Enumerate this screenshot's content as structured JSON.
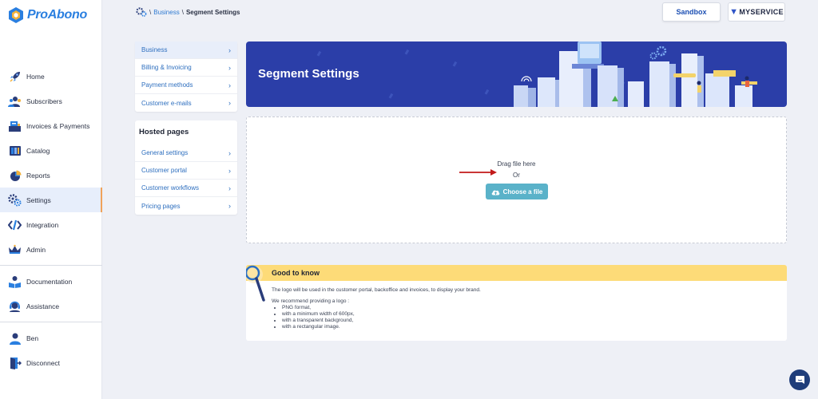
{
  "app": {
    "name": "ProAbono"
  },
  "sidebar": {
    "items": [
      {
        "label": "Home",
        "icon": "rocket-icon"
      },
      {
        "label": "Subscribers",
        "icon": "users-icon"
      },
      {
        "label": "Invoices & Payments",
        "icon": "cash-register-icon"
      },
      {
        "label": "Catalog",
        "icon": "catalog-icon"
      },
      {
        "label": "Reports",
        "icon": "pie-chart-icon"
      },
      {
        "label": "Settings",
        "icon": "gears-icon",
        "active": true
      },
      {
        "label": "Integration",
        "icon": "code-icon"
      },
      {
        "label": "Admin",
        "icon": "crown-icon"
      }
    ],
    "help_items": [
      {
        "label": "Documentation",
        "icon": "reader-icon"
      },
      {
        "label": "Assistance",
        "icon": "headset-icon"
      }
    ],
    "user_items": [
      {
        "label": "Ben",
        "icon": "user-icon"
      },
      {
        "label": "Disconnect",
        "icon": "door-icon"
      }
    ]
  },
  "breadcrumb": {
    "separator": "\\",
    "link": "Business",
    "current": "Segment Settings"
  },
  "header": {
    "sandbox_label": "Sandbox",
    "brand": "MYSERVICE"
  },
  "business_menu": [
    {
      "label": "Business",
      "active": true
    },
    {
      "label": "Billing & Invoicing"
    },
    {
      "label": "Payment methods"
    },
    {
      "label": "Customer e-mails"
    }
  ],
  "hosted_pages": {
    "title": "Hosted pages",
    "items": [
      {
        "label": "General settings"
      },
      {
        "label": "Customer portal"
      },
      {
        "label": "Customer workflows"
      },
      {
        "label": "Pricing pages"
      }
    ]
  },
  "banner": {
    "title": "Segment Settings"
  },
  "upload": {
    "drag_text": "Drag file here",
    "or_text": "Or",
    "button_label": "Choose a file"
  },
  "info": {
    "title": "Good to know",
    "intro": "The logo will be used in the customer portal, backoffice and invoices, to display your brand.",
    "lead": "We recommend providing a logo :",
    "bullets": [
      "PNG format,",
      "with a minimum width of 600px,",
      "with a transparent background,",
      "with a rectangular image."
    ]
  },
  "colors": {
    "accent": "#2e7ad1",
    "banner": "#2b3ea8",
    "info_header": "#fddb78",
    "button": "#5ab2c9",
    "active_marker": "#f0a35a"
  }
}
